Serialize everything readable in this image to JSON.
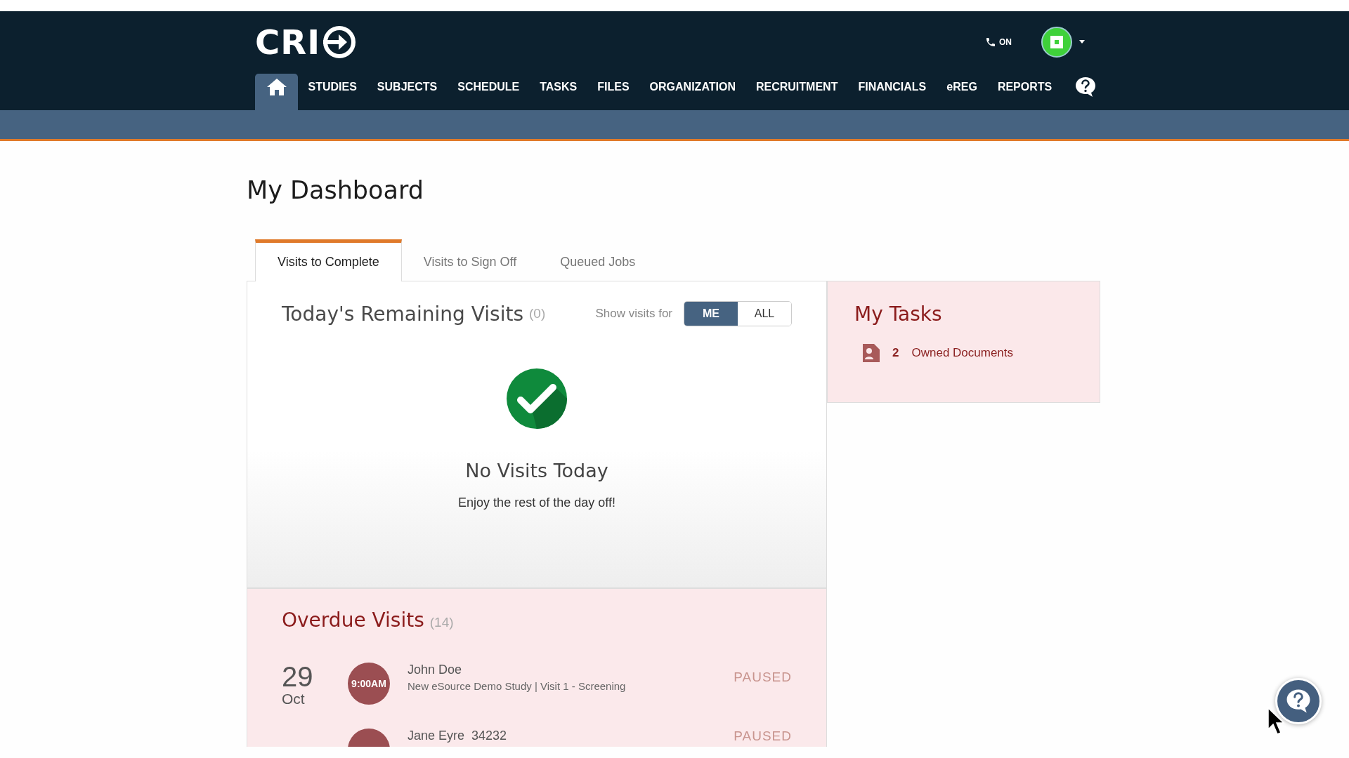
{
  "header": {
    "logo": "CRI",
    "phone_status": "ON"
  },
  "nav": [
    {
      "kind": "home",
      "selected": true
    },
    {
      "kind": "link",
      "label": "STUDIES",
      "selected": false
    },
    {
      "kind": "link",
      "label": "SUBJECTS",
      "selected": false
    },
    {
      "kind": "link",
      "label": "SCHEDULE",
      "selected": false
    },
    {
      "kind": "link",
      "label": "TASKS",
      "selected": false
    },
    {
      "kind": "link",
      "label": "FILES",
      "selected": false
    },
    {
      "kind": "link",
      "label": "ORGANIZATION",
      "selected": false
    },
    {
      "kind": "link",
      "label": "RECRUITMENT",
      "selected": false
    },
    {
      "kind": "link",
      "label": "FINANCIALS",
      "selected": false
    },
    {
      "kind": "link",
      "label": "eREG",
      "selected": false
    },
    {
      "kind": "link",
      "label": "REPORTS",
      "selected": false
    },
    {
      "kind": "help",
      "selected": false
    }
  ],
  "page_title": "My Dashboard",
  "tabs": [
    {
      "label": "Visits to Complete",
      "selected": true
    },
    {
      "label": "Visits to Sign Off",
      "selected": false
    },
    {
      "label": "Queued Jobs",
      "selected": false
    }
  ],
  "remaining": {
    "title": "Today's Remaining Visits",
    "count": "(0)",
    "filter_label": "Show visits for",
    "filter_options": [
      {
        "label": "ME",
        "selected": true
      },
      {
        "label": "ALL",
        "selected": false
      }
    ],
    "empty_title": "No Visits Today",
    "empty_message": "Enjoy the rest of the day off!"
  },
  "tasks": {
    "title": "My Tasks",
    "items": [
      {
        "count": "2",
        "label": "Owned Documents"
      }
    ]
  },
  "overdue": {
    "title": "Overdue Visits",
    "count": "(14)",
    "visits": [
      {
        "day": "29",
        "month": "Oct",
        "time": "9:00AM",
        "name": "John Doe",
        "detail": "New eSource Demo Study | Visit 1 - Screening",
        "status": "PAUSED"
      },
      {
        "name": "Jane Eyre  34232",
        "status": "PAUSED"
      }
    ]
  }
}
